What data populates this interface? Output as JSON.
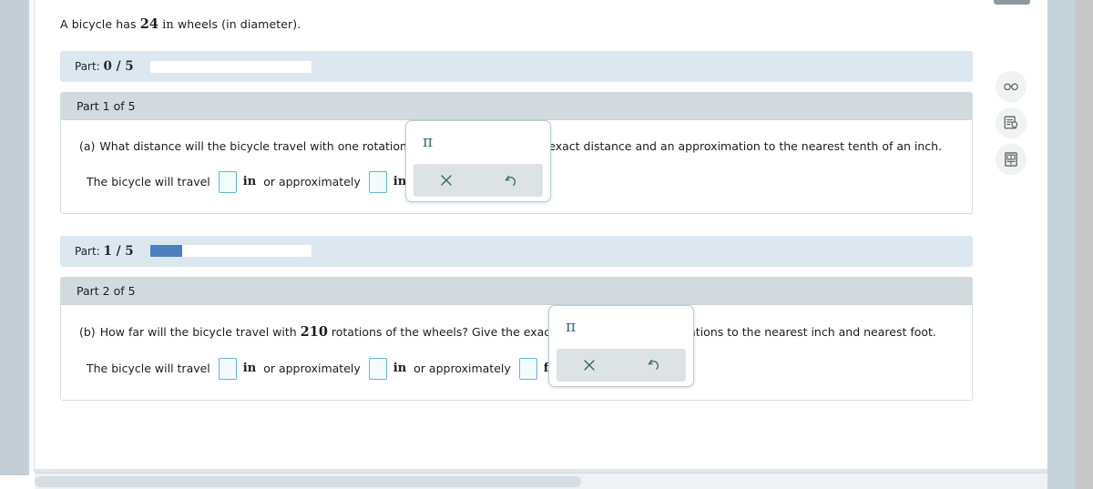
{
  "problem": {
    "intro_prefix": "A bicycle has ",
    "intro_value": "24",
    "intro_unit": "in",
    "intro_suffix": " wheels (in diameter)."
  },
  "progress_bars": [
    {
      "label_prefix": "Part: ",
      "label_value": "0 / 5",
      "fill_percent": 0
    },
    {
      "label_prefix": "Part: ",
      "label_value": "1 / 5",
      "fill_percent": 20
    }
  ],
  "parts": [
    {
      "header": "Part 1 of 5",
      "question_label": "(a)",
      "question_text_1": "What distance will the bicycle travel with one rotation of the wheels? Give the exact distance and an approximation to the nearest tenth of an inch.",
      "answer_lead": "The bicycle will travel",
      "connector_1": "or approximately",
      "units": [
        "in",
        "in"
      ],
      "period": "."
    },
    {
      "header": "Part 2 of 5",
      "question_label": "(b)",
      "question_prefix": "How far will the bicycle travel with ",
      "question_value": "210",
      "question_suffix": " rotations of the wheels? Give the exact distance and approximations to the nearest inch and nearest foot.",
      "answer_lead": "The bicycle will travel",
      "connector_1": "or approximately",
      "connector_2": "or approximately",
      "units": [
        "in",
        "in",
        "ft"
      ],
      "period": "."
    }
  ],
  "keypad": {
    "symbol": "π",
    "clear_label": "clear",
    "undo_label": "undo"
  },
  "tool_dock": [
    {
      "name": "glasses-icon",
      "title": "Reading tools"
    },
    {
      "name": "hint-document-icon",
      "title": "Hints"
    },
    {
      "name": "calculator-icon",
      "title": "Calculator"
    }
  ],
  "colors": {
    "accent_blue": "#4a80c0",
    "band_bg": "#dce7ef",
    "part_header_bg": "#d2dadd",
    "input_border": "#63b6cf",
    "keypad_text": "#3e6878"
  }
}
